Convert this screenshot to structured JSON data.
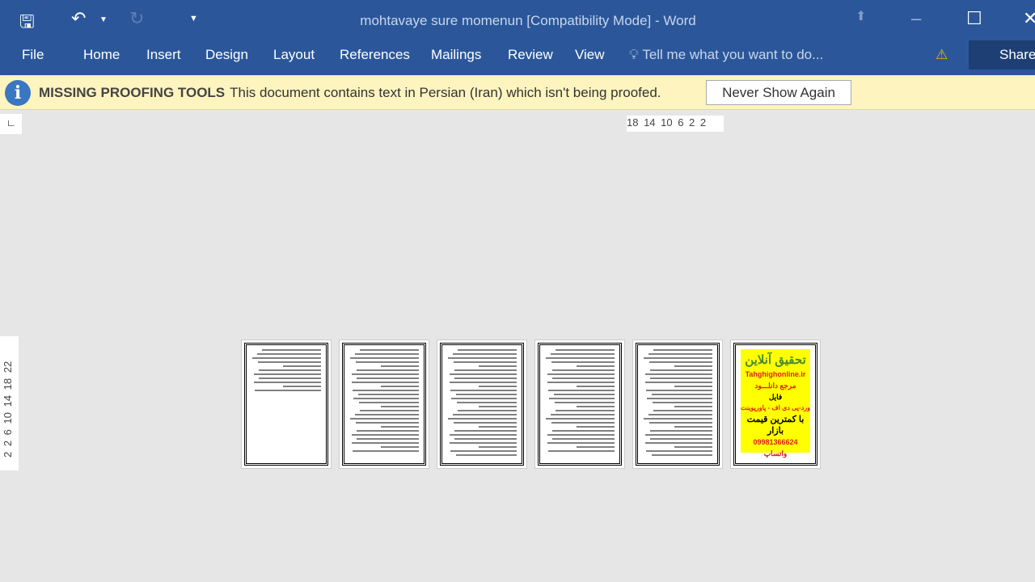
{
  "window": {
    "title": "mohtavaye sure momenun [Compatibility Mode] - Word"
  },
  "quick_access": {
    "save": "save-icon",
    "undo": "undo-icon",
    "redo": "redo-icon",
    "customize": "customize-icon"
  },
  "ribbon": {
    "tabs": [
      "File",
      "Home",
      "Insert",
      "Design",
      "Layout",
      "References",
      "Mailings",
      "Review",
      "View"
    ],
    "tell_me": "Tell me what you want to do...",
    "share": "Share"
  },
  "message_bar": {
    "title": "MISSING PROOFING TOOLS",
    "text": "This document contains text in Persian (Iran) which isn't being proofed.",
    "button": "Never Show Again"
  },
  "rulers": {
    "horizontal": "18 14 10 6 2 2",
    "vertical": "2 2 6 10 14 18 22"
  },
  "ad_page": {
    "lines": [
      "تحقیق آنلاین",
      "Tahghighonline.ir",
      "مرجع دانلـــود",
      "فایل",
      "ورد-پی دی اف - پاورپوینت",
      "با کمترین قیمت بازار",
      "09981366624 واتساپ"
    ]
  },
  "colors": {
    "brand": "#2b579a",
    "message_bar": "#fdf4bf",
    "ad_bg": "#ffff00"
  }
}
